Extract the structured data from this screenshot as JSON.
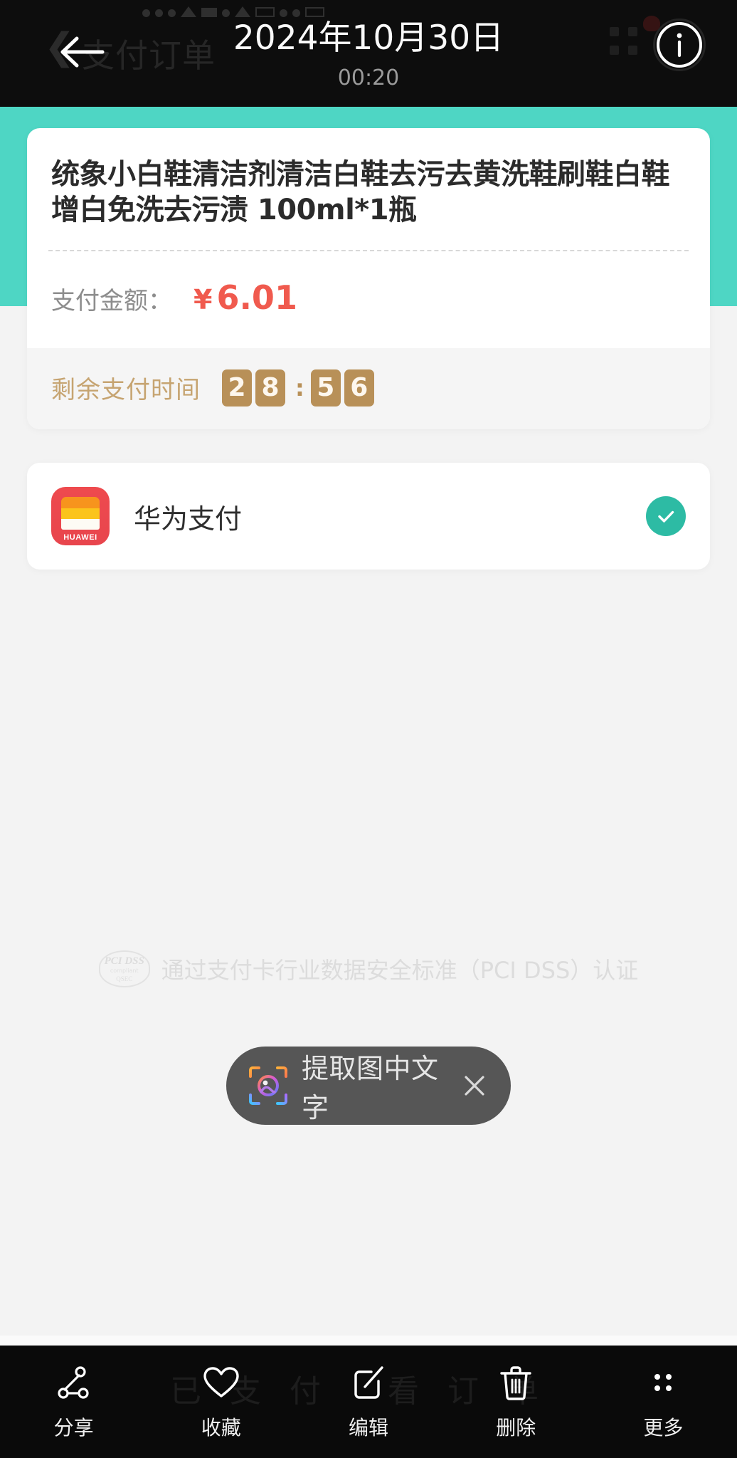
{
  "gallery_header": {
    "back_icon": "back-arrow-icon",
    "date": "2024年10月30日",
    "time": "00:20",
    "info_icon": "info-circle-icon",
    "ghost_title": "支付订单",
    "ghost_back_icon": "chevron-left-icon",
    "ghost_grid_icon": "grid-dots-icon"
  },
  "order_card": {
    "product_title": "统象小白鞋清洁剂清洁白鞋去污去黄洗鞋刷鞋白鞋增白免洗去污渍 100ml*1瓶",
    "amount_label": "支付金额：",
    "currency_symbol": "¥",
    "amount_value": "6.01",
    "countdown_label": "剩余支付时间",
    "countdown_digits": [
      "2",
      "8",
      "5",
      "6"
    ],
    "countdown_separator": ":"
  },
  "payment_method": {
    "icon": "huawei-pay-icon",
    "icon_wordmark": "HUAWEI",
    "name": "华为支付",
    "selected_icon": "check-circle-icon",
    "selected": true
  },
  "footer_watermark": {
    "badge_line1": "PCI DSS",
    "badge_line2": "compliant",
    "badge_line3": "QSEC",
    "text": "通过支付卡行业数据安全标准（PCI DSS）认证"
  },
  "ocr_pill": {
    "scan_icon": "ai-scan-icon",
    "label": "提取图中文字",
    "close_icon": "close-icon"
  },
  "bottom_toolbar": {
    "ghost_text": "已支付 看订单",
    "items": [
      {
        "icon": "share-icon",
        "label": "分享"
      },
      {
        "icon": "heart-icon",
        "label": "收藏"
      },
      {
        "icon": "edit-icon",
        "label": "编辑"
      },
      {
        "icon": "trash-icon",
        "label": "删除"
      },
      {
        "icon": "more-dots-icon",
        "label": "更多"
      }
    ]
  },
  "colors": {
    "teal_band": "#4ed6c4",
    "price_red": "#f05a4e",
    "countdown_gold": "#b89058",
    "countdown_label": "#c6a471",
    "check_teal": "#2dbba4",
    "huawei_red": "#ee4a4e",
    "header_dark": "#0d0d0d"
  }
}
